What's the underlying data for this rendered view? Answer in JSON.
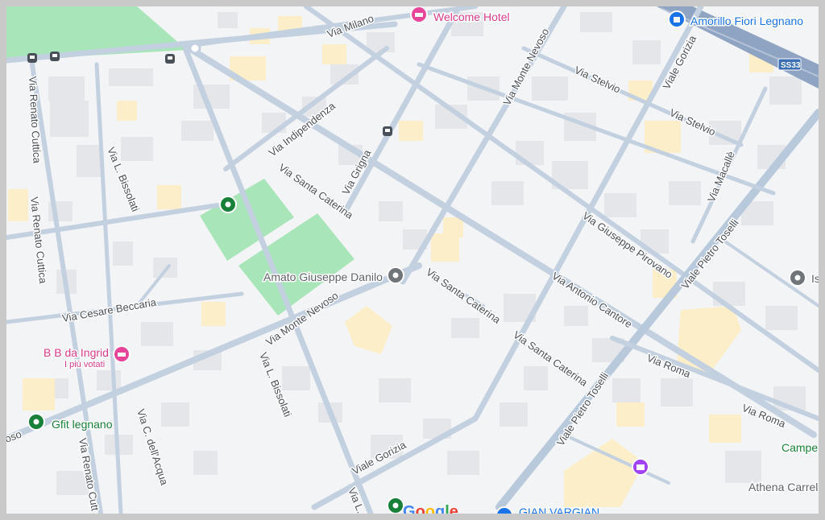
{
  "colors": {
    "background": "#f3f4f6",
    "road": "#c2d0e0",
    "road_major": "#aec3d8",
    "building": "#e6e8ec",
    "building_yellow": "#fbeec8",
    "park": "#a8e6b9",
    "highway": "#8fa3c2"
  },
  "streets": {
    "via_milano": "Via Milano",
    "via_renato_cuttica_1": "Via Renato Cuttica",
    "via_renato_cuttica_2": "Via Renato Cuttica",
    "via_renato_cuttica_3": "Via Renato Cutt",
    "via_bissolati_1": "Via L. Bissolati",
    "via_bissolati_2": "Via L. Bissolati",
    "via_bissolati_3": "Via L.",
    "via_indipendenza": "Via Indipendenza",
    "via_santa_caterina_1": "Via Santa Caterina",
    "via_santa_caterina_2": "Via Santa Caterina",
    "via_santa_caterina_3": "Via Santa Caterina",
    "via_grigna": "Via Grigna",
    "via_monte_nevoso_1": "Via Monte Nevoso",
    "via_monte_nevoso_2": "Via Monte Nevoso",
    "via_monte_nevoso_3": "oso",
    "via_stelvio_1": "Via Stelvio",
    "via_stelvio_2": "Via Stelvio",
    "viale_gorizia_1": "Viale Gorizia",
    "viale_gorizia_2": "Viale Gorizia",
    "via_giuseppe_pirovano": "Via Giuseppe Pirovano",
    "via_antonio_cantore": "Via Antonio Cantore",
    "via_macalle": "Via Macallè",
    "viale_pietro_toselli_1": "Viale Pietro Toselli",
    "viale_pietro_toselli_2": "Viale Pietro Toselli",
    "via_roma_1": "Via Roma",
    "via_roma_2": "Via Roma",
    "via_cesare_beccaria": "Via Cesare Beccaria",
    "via_c_dell_acqua": "Via C. dell'Acqua"
  },
  "pois": {
    "welcome_hotel": "Welcome Hotel",
    "amorillo": "Amorillo Fiori Legnano",
    "amato": "Amato Giuseppe Danilo",
    "bb_ingrid": "B B da Ingrid",
    "bb_ingrid_sub": "I più votati",
    "gfit": "Gfit legnano",
    "campe": "Campe",
    "athena": "Athena Carrel",
    "gian_vargian": "GIAN VARGIAN",
    "is": "Is"
  },
  "highway_shield": "SS33",
  "logo_letters": [
    "G",
    "o",
    "o",
    "g",
    "l",
    "e"
  ],
  "logo_colors": [
    "#4285f4",
    "#ea4335",
    "#fbbc04",
    "#4285f4",
    "#34a853",
    "#ea4335"
  ]
}
